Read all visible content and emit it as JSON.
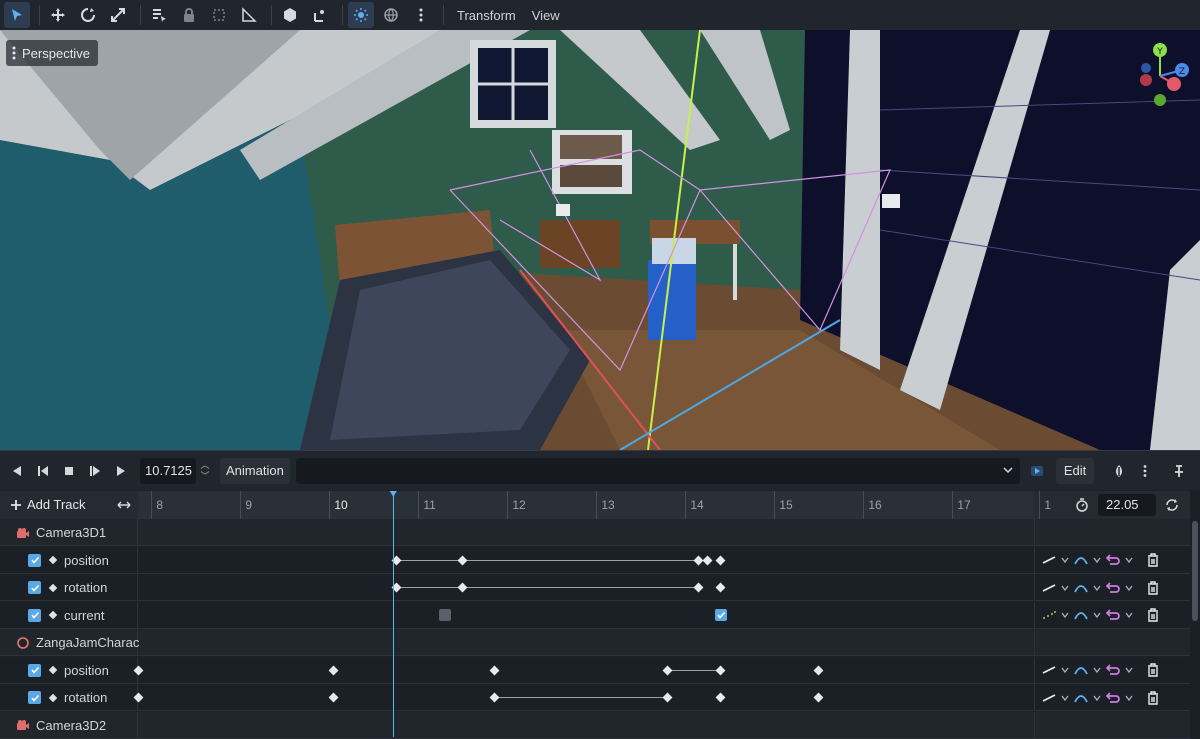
{
  "toolbar": {
    "icons": [
      "select-icon",
      "move-icon",
      "rotate-icon",
      "scale-icon",
      "list-select-icon",
      "lock-icon",
      "group-icon",
      "ruler-icon",
      "snap-icon",
      "local-space-icon",
      "sun-icon",
      "globe-icon",
      "more-icon"
    ],
    "menu_transform": "Transform",
    "menu_view": "View"
  },
  "viewport": {
    "mode_label": "Perspective"
  },
  "animation": {
    "current_time": "10.7125",
    "label": "Animation",
    "selected_animation": "",
    "edit_label": "Edit",
    "length": "22.05"
  },
  "timeline": {
    "add_track_label": "Add Track",
    "ticks": [
      {
        "label": "8",
        "bright": false
      },
      {
        "label": "9",
        "bright": false
      },
      {
        "label": "10",
        "bright": true
      },
      {
        "label": "11",
        "bright": false
      },
      {
        "label": "12",
        "bright": false
      },
      {
        "label": "13",
        "bright": false
      },
      {
        "label": "14",
        "bright": false
      },
      {
        "label": "15",
        "bright": false
      },
      {
        "label": "16",
        "bright": false
      },
      {
        "label": "17",
        "bright": false
      },
      {
        "label": "1",
        "bright": false
      }
    ],
    "playhead_time": 10.7125
  },
  "tracks": [
    {
      "type": "group",
      "name": "Camera3D1",
      "icon": "camera-icon"
    },
    {
      "type": "track",
      "name": "position",
      "keys": [
        10.75,
        11.5,
        14.15,
        14.25,
        14.4
      ],
      "segments": [
        [
          10.75,
          14.15
        ]
      ]
    },
    {
      "type": "track",
      "name": "rotation",
      "keys": [
        10.75,
        11.5,
        14.15,
        14.4
      ],
      "segments": [
        [
          10.75,
          14.15
        ]
      ]
    },
    {
      "type": "track",
      "name": "current",
      "discrete": [
        {
          "time": 11.3,
          "checked": false
        },
        {
          "time": 14.4,
          "checked": true
        }
      ]
    },
    {
      "type": "group",
      "name": "ZangaJamCharac",
      "icon": "character-icon"
    },
    {
      "type": "track",
      "name": "position",
      "keys": [
        7.85,
        10.05,
        11.85,
        13.8,
        14.4,
        15.5
      ],
      "segments": [
        [
          13.8,
          14.4
        ]
      ]
    },
    {
      "type": "track",
      "name": "rotation",
      "keys": [
        7.85,
        10.05,
        11.85,
        13.8,
        14.4,
        15.5
      ],
      "segments": [
        [
          11.85,
          13.8
        ]
      ]
    },
    {
      "type": "group",
      "name": "Camera3D2",
      "icon": "camera-icon"
    }
  ],
  "colors": {
    "accent": "#5fb2f0",
    "checkbox": "#5aa8e6",
    "camera_icon": "#e06c6c",
    "interp_blue": "#5fb2f0",
    "loop_pink": "#d27be0"
  }
}
